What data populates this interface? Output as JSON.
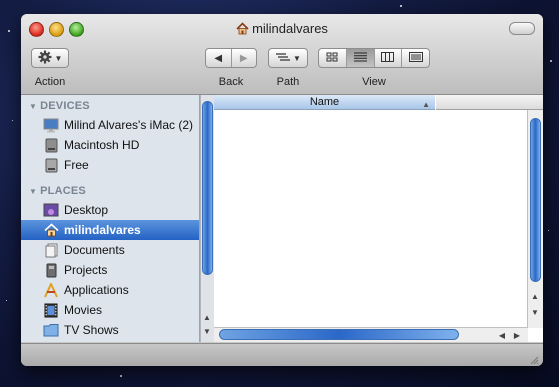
{
  "window": {
    "title": "milindalvares"
  },
  "toolbar": {
    "action_label": "Action",
    "back_label": "Back",
    "path_label": "Path",
    "view_label": "View"
  },
  "sidebar": {
    "devices_header": "DEVICES",
    "places_header": "PLACES",
    "devices": [
      {
        "label": "Milind Alvares's iMac (2)",
        "icon": "imac-icon"
      },
      {
        "label": "Macintosh HD",
        "icon": "hard-drive-icon"
      },
      {
        "label": "Free",
        "icon": "drive-icon"
      }
    ],
    "places": [
      {
        "label": "Desktop",
        "icon": "desktop-folder-icon"
      },
      {
        "label": "milindalvares",
        "icon": "home-icon",
        "selected": true
      },
      {
        "label": "Documents",
        "icon": "documents-icon"
      },
      {
        "label": "Projects",
        "icon": "projects-icon"
      },
      {
        "label": "Applications",
        "icon": "applications-icon"
      },
      {
        "label": "Movies",
        "icon": "movies-icon"
      },
      {
        "label": "TV Shows",
        "icon": "folder-icon"
      }
    ]
  },
  "list": {
    "column_name": "Name"
  },
  "colors": {
    "selection": "#2f6fcb",
    "sidebar_bg": "#dde4ec",
    "scroll_thumb": "#3b76d0"
  }
}
